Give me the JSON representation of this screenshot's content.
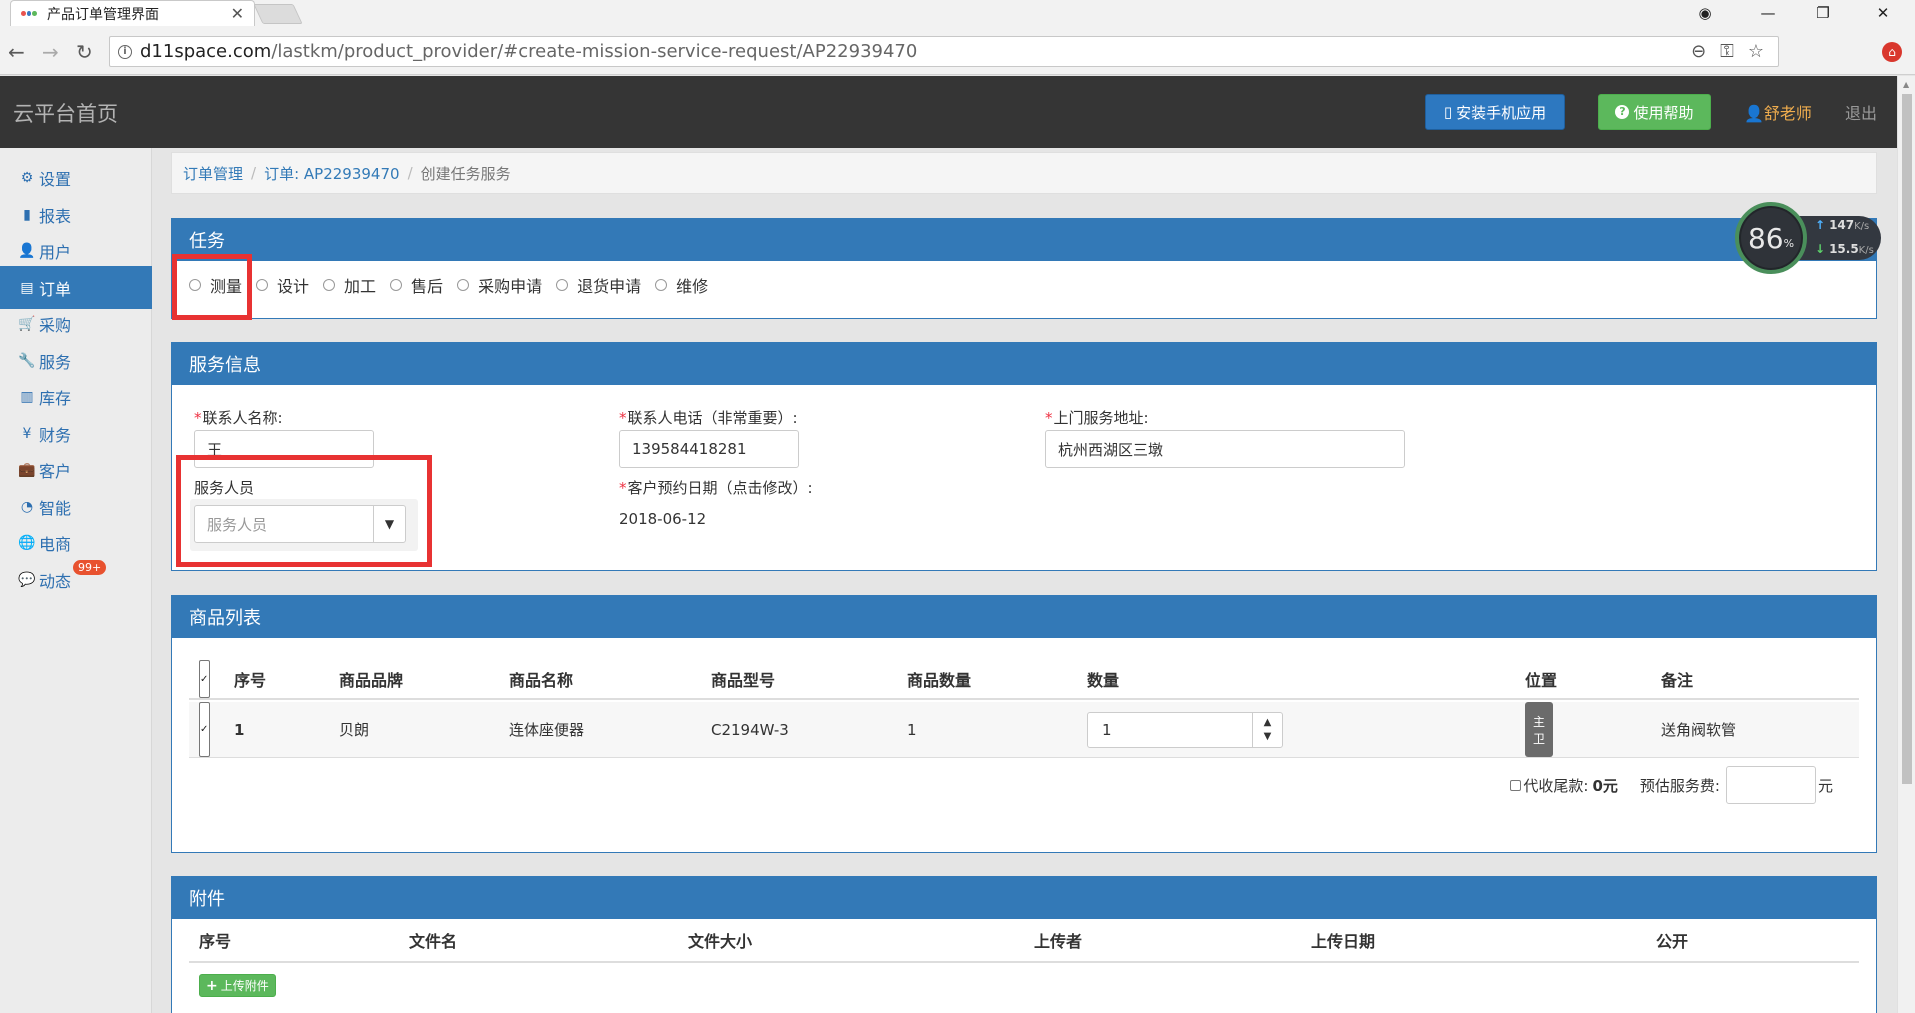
{
  "browser": {
    "tab_title": "产品订单管理界面",
    "tab_close": "✕",
    "url_host": "d11space.com",
    "url_path": "/lastkm/product_provider/#create-mission-service-request/AP22939470",
    "window_controls": {
      "account": "◉",
      "minimize": "—",
      "restore": "❐",
      "close": "✕"
    }
  },
  "header": {
    "brand": "云平台首页",
    "install_app": "安装手机应用",
    "help": "使用帮助",
    "user": "舒老师",
    "logout": "退出"
  },
  "sidebar": {
    "items": [
      {
        "label": "设置",
        "icon": "gear-icon",
        "glyph": "⚙"
      },
      {
        "label": "报表",
        "icon": "bar-chart-icon",
        "glyph": "▮"
      },
      {
        "label": "用户",
        "icon": "user-icon",
        "glyph": "👤"
      },
      {
        "label": "订单",
        "icon": "list-icon",
        "glyph": "▤"
      },
      {
        "label": "采购",
        "icon": "cart-icon",
        "glyph": "🛒"
      },
      {
        "label": "服务",
        "icon": "wrench-icon",
        "glyph": "🔧"
      },
      {
        "label": "库存",
        "icon": "barcode-icon",
        "glyph": "▥"
      },
      {
        "label": "财务",
        "icon": "yen-icon",
        "glyph": "¥"
      },
      {
        "label": "客户",
        "icon": "briefcase-icon",
        "glyph": "💼"
      },
      {
        "label": "智能",
        "icon": "dashboard-icon",
        "glyph": "◔"
      },
      {
        "label": "电商",
        "icon": "globe-icon",
        "glyph": "🌐"
      },
      {
        "label": "动态",
        "icon": "comment-icon",
        "glyph": "💬",
        "badge": "99+"
      }
    ],
    "active_index": 3
  },
  "breadcrumb": {
    "orders": "订单管理",
    "order": "订单: AP22939470",
    "current": "创建任务服务"
  },
  "task_panel": {
    "title": "任务",
    "options": [
      "测量",
      "设计",
      "加工",
      "售后",
      "采购申请",
      "退货申请",
      "维修"
    ]
  },
  "service_panel": {
    "title": "服务信息",
    "contact_name_label": "联系人名称:",
    "contact_name_value": "王",
    "contact_phone_label": "联系人电话（非常重要）:",
    "contact_phone_value": "139584418281",
    "address_label": "上门服务地址:",
    "address_value": "杭州西湖区三墩",
    "staff_label": "服务人员",
    "staff_placeholder": "服务人员",
    "appointment_label": "客户预约日期（点击修改）:",
    "appointment_value": "2018-06-12"
  },
  "products_panel": {
    "title": "商品列表",
    "columns": [
      "序号",
      "商品品牌",
      "商品名称",
      "商品型号",
      "商品数量",
      "数量",
      "位置",
      "备注"
    ],
    "rows": [
      {
        "index": "1",
        "brand": "贝朗",
        "name": "连体座便器",
        "model": "C2194W-3",
        "count": "1",
        "quantity": "1",
        "location": "主卫",
        "remark": "送角阀软管"
      }
    ],
    "collect_label": "代收尾款:",
    "collect_value": "0元",
    "fee_label": "预估服务费:",
    "fee_unit": "元"
  },
  "attachments_panel": {
    "title": "附件",
    "columns": [
      "序号",
      "文件名",
      "文件大小",
      "上传者",
      "上传日期",
      "公开"
    ],
    "upload_button": "上传附件"
  },
  "speed_widget": {
    "percent": "86",
    "percent_unit": "%",
    "upload": "147",
    "download": "15.5",
    "unit": "K/s"
  }
}
